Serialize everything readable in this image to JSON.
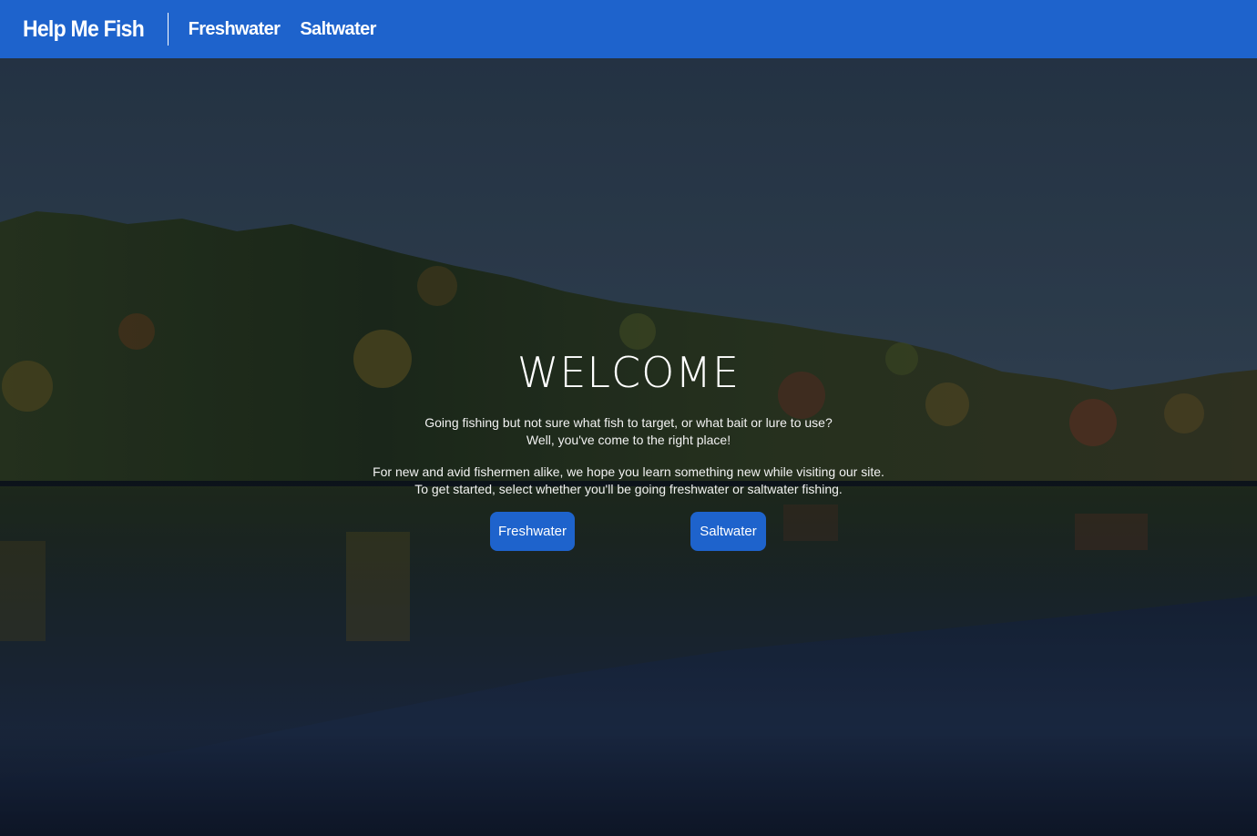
{
  "nav": {
    "brand": "Help Me Fish",
    "links": [
      "Freshwater",
      "Saltwater"
    ]
  },
  "hero": {
    "title": "WELCOME",
    "paragraph1": [
      "Going fishing but not sure what fish to target, or what bait or lure to use?",
      "Well, you've come to the right place!"
    ],
    "paragraph2": [
      "For new and avid fishermen alike, we hope you learn something new while visiting our site.",
      "To get started, select whether you'll be going freshwater or saltwater fishing."
    ],
    "buttons": [
      "Freshwater",
      "Saltwater"
    ]
  },
  "colors": {
    "navbar": "#1e63cc",
    "button": "#1e63cc",
    "text": "#ffffff"
  }
}
